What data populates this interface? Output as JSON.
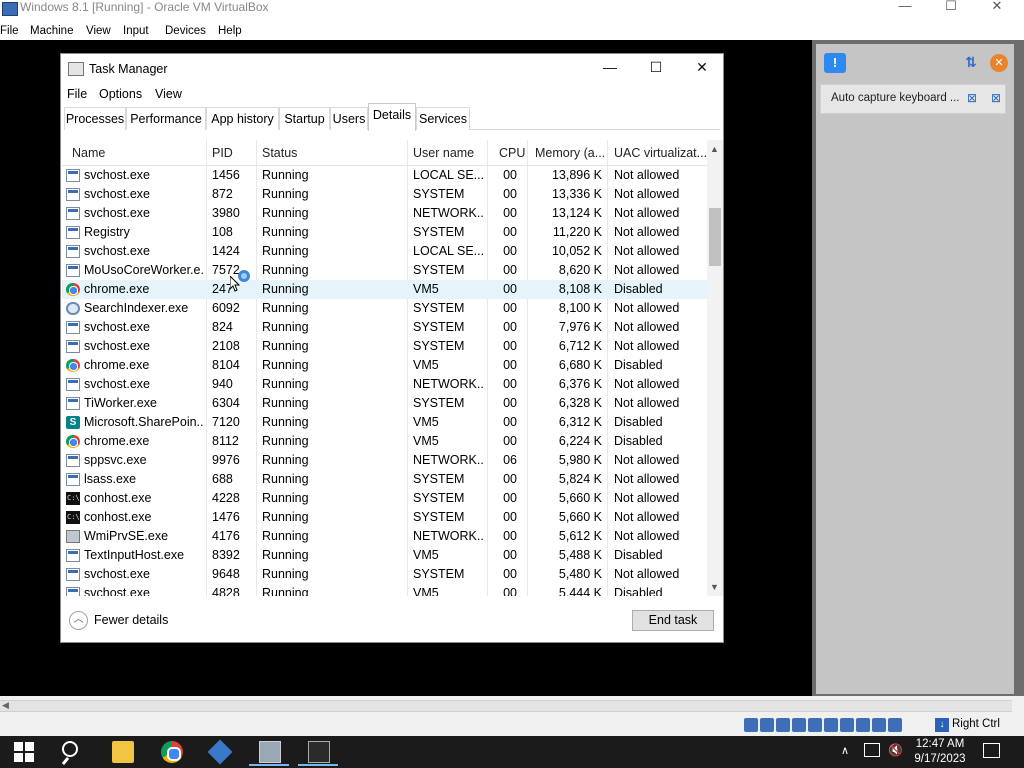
{
  "vbox": {
    "title": "Windows 8.1 [Running] - Oracle VM VirtualBox",
    "menu": [
      "File",
      "Machine",
      "View",
      "Input",
      "Devices",
      "Help"
    ],
    "window_controls": [
      "—",
      "☐",
      "✕"
    ],
    "panel": {
      "capture_text": "Auto capture keyboard ...",
      "notify_icon": "!",
      "sort_icon": "⇅",
      "close_icon": "✕",
      "capture_icon_1": "⊠",
      "capture_icon_2": "⊠"
    },
    "status": {
      "right_ctrl_label": "Right Ctrl",
      "left_arrow": "◀"
    }
  },
  "task_manager": {
    "title": "Task Manager",
    "window_controls": [
      "—",
      "☐",
      "✕"
    ],
    "menu": [
      "File",
      "Options",
      "View"
    ],
    "tabs": [
      "Processes",
      "Performance",
      "App history",
      "Startup",
      "Users",
      "Details",
      "Services"
    ],
    "active_tab": "Details",
    "columns": [
      "Name",
      "PID",
      "Status",
      "User name",
      "CPU",
      "Memory (a...",
      "UAC virtualizat..."
    ],
    "rows": [
      {
        "name": "svchost.exe",
        "pid": "1456",
        "status": "Running",
        "user": "LOCAL SE...",
        "cpu": "00",
        "memory": "13,896 K",
        "uac": "Not allowed",
        "icon": "exe"
      },
      {
        "name": "svchost.exe",
        "pid": "872",
        "status": "Running",
        "user": "SYSTEM",
        "cpu": "00",
        "memory": "13,336 K",
        "uac": "Not allowed",
        "icon": "exe"
      },
      {
        "name": "svchost.exe",
        "pid": "3980",
        "status": "Running",
        "user": "NETWORK...",
        "cpu": "00",
        "memory": "13,124 K",
        "uac": "Not allowed",
        "icon": "exe"
      },
      {
        "name": "Registry",
        "pid": "108",
        "status": "Running",
        "user": "SYSTEM",
        "cpu": "00",
        "memory": "11,220 K",
        "uac": "Not allowed",
        "icon": "exe"
      },
      {
        "name": "svchost.exe",
        "pid": "1424",
        "status": "Running",
        "user": "LOCAL SE...",
        "cpu": "00",
        "memory": "10,052 K",
        "uac": "Not allowed",
        "icon": "exe"
      },
      {
        "name": "MoUsoCoreWorker.e...",
        "pid": "7572",
        "status": "Running",
        "user": "SYSTEM",
        "cpu": "00",
        "memory": "8,620 K",
        "uac": "Not allowed",
        "icon": "exe"
      },
      {
        "name": "chrome.exe",
        "pid": "247",
        "status": "Running",
        "user": "VM5",
        "cpu": "00",
        "memory": "8,108 K",
        "uac": "Disabled",
        "icon": "chrome"
      },
      {
        "name": "SearchIndexer.exe",
        "pid": "6092",
        "status": "Running",
        "user": "SYSTEM",
        "cpu": "00",
        "memory": "8,100 K",
        "uac": "Not allowed",
        "icon": "search"
      },
      {
        "name": "svchost.exe",
        "pid": "824",
        "status": "Running",
        "user": "SYSTEM",
        "cpu": "00",
        "memory": "7,976 K",
        "uac": "Not allowed",
        "icon": "exe"
      },
      {
        "name": "svchost.exe",
        "pid": "2108",
        "status": "Running",
        "user": "SYSTEM",
        "cpu": "00",
        "memory": "6,712 K",
        "uac": "Not allowed",
        "icon": "exe"
      },
      {
        "name": "chrome.exe",
        "pid": "8104",
        "status": "Running",
        "user": "VM5",
        "cpu": "00",
        "memory": "6,680 K",
        "uac": "Disabled",
        "icon": "chrome"
      },
      {
        "name": "svchost.exe",
        "pid": "940",
        "status": "Running",
        "user": "NETWORK...",
        "cpu": "00",
        "memory": "6,376 K",
        "uac": "Not allowed",
        "icon": "exe"
      },
      {
        "name": "TiWorker.exe",
        "pid": "6304",
        "status": "Running",
        "user": "SYSTEM",
        "cpu": "00",
        "memory": "6,328 K",
        "uac": "Not allowed",
        "icon": "exe"
      },
      {
        "name": "Microsoft.SharePoin...",
        "pid": "7120",
        "status": "Running",
        "user": "VM5",
        "cpu": "00",
        "memory": "6,312 K",
        "uac": "Disabled",
        "icon": "sharepoint"
      },
      {
        "name": "chrome.exe",
        "pid": "8112",
        "status": "Running",
        "user": "VM5",
        "cpu": "00",
        "memory": "6,224 K",
        "uac": "Disabled",
        "icon": "chrome"
      },
      {
        "name": "sppsvc.exe",
        "pid": "9976",
        "status": "Running",
        "user": "NETWORK...",
        "cpu": "06",
        "memory": "5,980 K",
        "uac": "Not allowed",
        "icon": "exe"
      },
      {
        "name": "lsass.exe",
        "pid": "688",
        "status": "Running",
        "user": "SYSTEM",
        "cpu": "00",
        "memory": "5,824 K",
        "uac": "Not allowed",
        "icon": "exe"
      },
      {
        "name": "conhost.exe",
        "pid": "4228",
        "status": "Running",
        "user": "SYSTEM",
        "cpu": "00",
        "memory": "5,660 K",
        "uac": "Not allowed",
        "icon": "console"
      },
      {
        "name": "conhost.exe",
        "pid": "1476",
        "status": "Running",
        "user": "SYSTEM",
        "cpu": "00",
        "memory": "5,660 K",
        "uac": "Not allowed",
        "icon": "console"
      },
      {
        "name": "WmiPrvSE.exe",
        "pid": "4176",
        "status": "Running",
        "user": "NETWORK...",
        "cpu": "00",
        "memory": "5,612 K",
        "uac": "Not allowed",
        "icon": "wmi"
      },
      {
        "name": "TextInputHost.exe",
        "pid": "8392",
        "status": "Running",
        "user": "VM5",
        "cpu": "00",
        "memory": "5,488 K",
        "uac": "Disabled",
        "icon": "exe"
      },
      {
        "name": "svchost.exe",
        "pid": "9648",
        "status": "Running",
        "user": "SYSTEM",
        "cpu": "00",
        "memory": "5,480 K",
        "uac": "Not allowed",
        "icon": "exe"
      },
      {
        "name": "svchost.exe",
        "pid": "4828",
        "status": "Running",
        "user": "VM5",
        "cpu": "00",
        "memory": "5,444 K",
        "uac": "Disabled",
        "icon": "exe"
      }
    ],
    "fewer_details_label": "Fewer details",
    "end_task_label": "End task"
  },
  "taskbar": {
    "time": "12:47 AM",
    "date": "9/17/2023",
    "tray_up_glyph": "∧",
    "volume_glyph": "🔇"
  }
}
